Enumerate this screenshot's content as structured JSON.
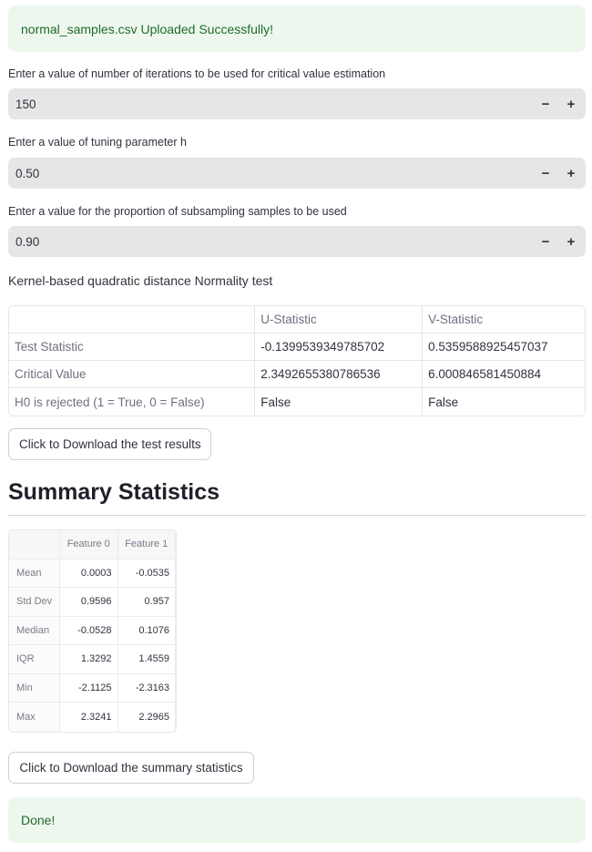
{
  "alerts": {
    "upload_success": "normal_samples.csv Uploaded Successfully!",
    "done": "Done!"
  },
  "inputs": {
    "iterations": {
      "label": "Enter a value of number of iterations to be used for critical value estimation",
      "value": "150"
    },
    "tuning_h": {
      "label": "Enter a value of tuning parameter h",
      "value": "0.50"
    },
    "subsample": {
      "label": "Enter a value for the proportion of subsampling samples to be used",
      "value": "0.90"
    },
    "minus_symbol": "−",
    "plus_symbol": "+"
  },
  "test": {
    "title": "Kernel-based quadratic distance Normality test",
    "headers": [
      "",
      "U-Statistic",
      "V-Statistic"
    ],
    "rows": [
      [
        "Test Statistic",
        "-0.1399539349785702",
        "0.5359588925457037"
      ],
      [
        "Critical Value",
        "2.3492655380786536",
        "6.000846581450884"
      ],
      [
        "H0 is rejected (1 = True, 0 = False)",
        "False",
        "False"
      ]
    ],
    "download_label": "Click to Download the test results"
  },
  "summary": {
    "heading": "Summary Statistics",
    "headers": [
      "",
      "Feature 0",
      "Feature 1"
    ],
    "rows": [
      [
        "Mean",
        "0.0003",
        "-0.0535"
      ],
      [
        "Std Dev",
        "0.9596",
        "0.957"
      ],
      [
        "Median",
        "-0.0528",
        "0.1076"
      ],
      [
        "IQR",
        "1.3292",
        "1.4559"
      ],
      [
        "Min",
        "-2.1125",
        "-2.3163"
      ],
      [
        "Max",
        "2.3241",
        "2.2965"
      ]
    ],
    "download_label": "Click to Download the summary statistics"
  },
  "colors": {
    "success_bg": "#eef7ee",
    "success_text": "#1f6b2c",
    "input_bg": "#e6e6e6"
  }
}
